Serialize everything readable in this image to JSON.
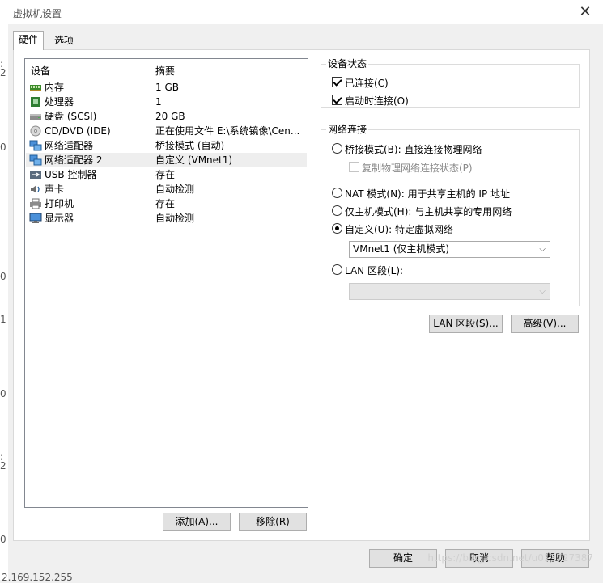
{
  "window": {
    "title": "虚拟机设置"
  },
  "left_marks": [
    ":",
    "2",
    "0",
    "0",
    "1",
    "0",
    ":",
    "2",
    "0"
  ],
  "bottom_fragment": "2.169.152.255",
  "tabs": [
    {
      "label": "硬件",
      "active": true
    },
    {
      "label": "选项",
      "active": false
    }
  ],
  "device_list": {
    "headers": {
      "device": "设备",
      "summary": "摘要"
    },
    "rows": [
      {
        "name": "内存",
        "summary": "1 GB",
        "icon": "memory-icon"
      },
      {
        "name": "处理器",
        "summary": "1",
        "icon": "processor-icon"
      },
      {
        "name": "硬盘 (SCSI)",
        "summary": "20 GB",
        "icon": "hard-disk-icon"
      },
      {
        "name": "CD/DVD (IDE)",
        "summary": "正在使用文件 E:\\系统镜像\\Cen...",
        "icon": "cd-dvd-icon"
      },
      {
        "name": "网络适配器",
        "summary": "桥接模式 (自动)",
        "icon": "network-adapter-icon"
      },
      {
        "name": "网络适配器 2",
        "summary": "自定义 (VMnet1)",
        "icon": "network-adapter-icon",
        "selected": true
      },
      {
        "name": "USB 控制器",
        "summary": "存在",
        "icon": "usb-icon"
      },
      {
        "name": "声卡",
        "summary": "自动检测",
        "icon": "sound-card-icon"
      },
      {
        "name": "打印机",
        "summary": "存在",
        "icon": "printer-icon"
      },
      {
        "name": "显示器",
        "summary": "自动检测",
        "icon": "display-icon"
      }
    ]
  },
  "buttons": {
    "add": "添加(A)...",
    "remove": "移除(R)",
    "lan_segments": "LAN 区段(S)...",
    "advanced": "高级(V)...",
    "ok": "确定",
    "cancel": "取消",
    "help": "帮助"
  },
  "device_status": {
    "label": "设备状态",
    "connected": {
      "label": "已连接(C)",
      "checked": true
    },
    "connect_at_power_on": {
      "label": "启动时连接(O)",
      "checked": true
    }
  },
  "network_connection": {
    "label": "网络连接",
    "bridged": {
      "label": "桥接模式(B): 直接连接物理网络",
      "checked": false
    },
    "replicate": {
      "label": "复制物理网络连接状态(P)",
      "checked": false,
      "disabled": true
    },
    "nat": {
      "label": "NAT 模式(N): 用于共享主机的 IP 地址",
      "checked": false
    },
    "host_only": {
      "label": "仅主机模式(H): 与主机共享的专用网络",
      "checked": false
    },
    "custom": {
      "label": "自定义(U): 特定虚拟网络",
      "checked": true
    },
    "custom_select": "VMnet1 (仅主机模式)",
    "lan_segment": {
      "label": "LAN 区段(L):",
      "checked": false
    },
    "lan_select": ""
  },
  "watermark": "https://blog.csdn.net/u013727387",
  "colors": {
    "selected_row": "#eeeeee",
    "button_bg": "#e1e1e1",
    "window_bg": "#f0f0f0"
  }
}
